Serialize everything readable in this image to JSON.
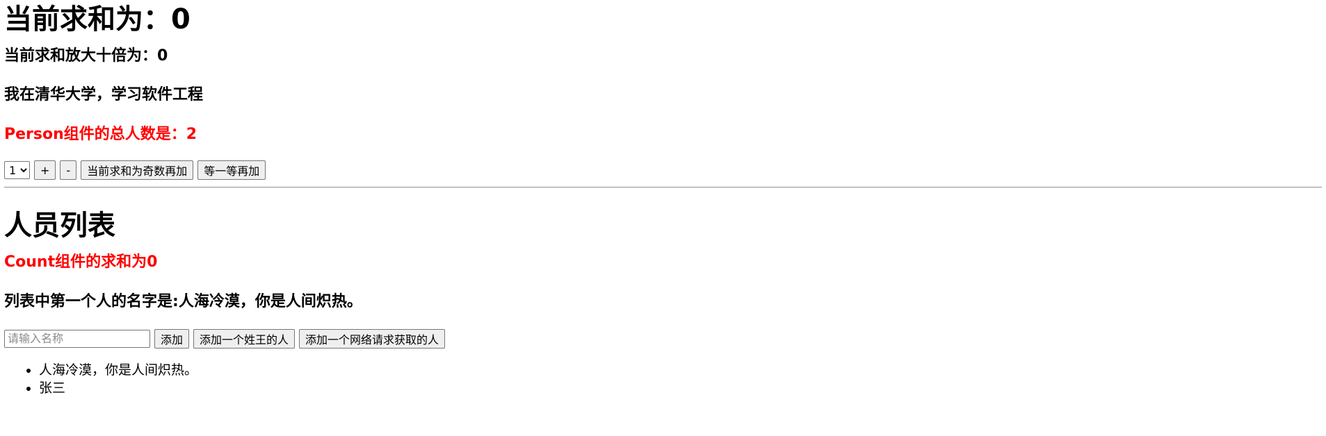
{
  "count": {
    "sum_label": "当前求和为：",
    "sum_value": "0",
    "ten_times_label": "当前求和放大十倍为：",
    "ten_times_value": "0",
    "school_text": "我在清华大学，学习软件工程",
    "person_total_label": "Person组件的总人数是：",
    "person_total_value": "2",
    "select": {
      "selected": "1",
      "options": [
        "1"
      ]
    },
    "buttons": {
      "plus": "+",
      "minus": "-",
      "odd_add": "当前求和为奇数再加",
      "wait_add": "等一等再加"
    }
  },
  "person": {
    "title": "人员列表",
    "count_sum_label": "Count组件的求和为",
    "count_sum_value": "0",
    "first_person_label": "列表中第一个人的名字是:",
    "first_person_value": "人海冷漠，你是人间炽热。",
    "input_placeholder": "请输入名称",
    "buttons": {
      "add": "添加",
      "add_wang": "添加一个姓王的人",
      "add_network": "添加一个网络请求获取的人"
    },
    "list": [
      "人海冷漠，你是人间炽热。",
      "张三"
    ]
  },
  "colors": {
    "highlight": "#ff0000",
    "text": "#000000"
  }
}
